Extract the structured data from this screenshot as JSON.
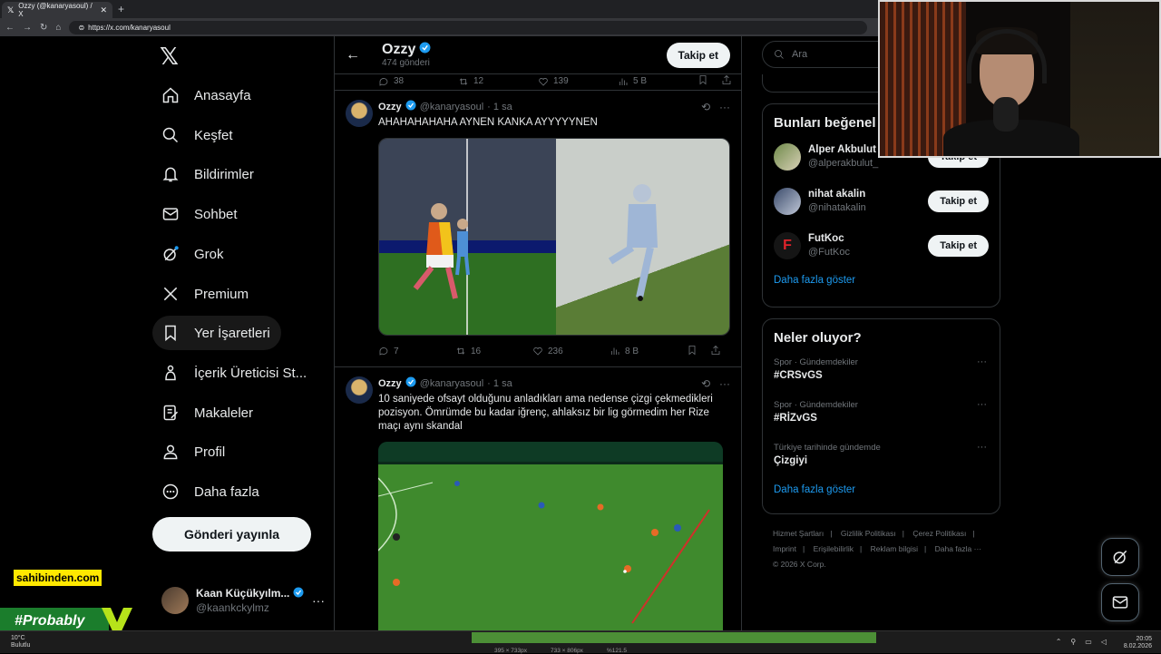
{
  "browser": {
    "tab_title": "Ozzy (@kanaryasoul) / X",
    "url": "https://x.com/kanaryasoul"
  },
  "nav": {
    "items": [
      {
        "label": "Anasayfa",
        "icon": "home-icon"
      },
      {
        "label": "Keşfet",
        "icon": "search-icon"
      },
      {
        "label": "Bildirimler",
        "icon": "bell-icon"
      },
      {
        "label": "Sohbet",
        "icon": "mail-icon"
      },
      {
        "label": "Grok",
        "icon": "grok-icon"
      },
      {
        "label": "Premium",
        "icon": "x-icon"
      },
      {
        "label": "Yer İşaretleri",
        "icon": "bookmark-icon"
      },
      {
        "label": "İçerik Üreticisi St...",
        "icon": "creator-icon"
      },
      {
        "label": "Makaleler",
        "icon": "article-icon"
      },
      {
        "label": "Profil",
        "icon": "person-icon"
      },
      {
        "label": "Daha fazla",
        "icon": "more-circle-icon"
      }
    ],
    "post_button": "Gönderi yayınla",
    "account": {
      "name": "Kaan Küçükyılm...",
      "handle": "@kaankckylmz"
    }
  },
  "profile_header": {
    "name": "Ozzy",
    "posts": "474 gönderi",
    "follow": "Takip et"
  },
  "top_actions": {
    "replies": "38",
    "reposts": "12",
    "likes": "139",
    "views": "5 B"
  },
  "tweets": [
    {
      "name": "Ozzy",
      "handle": "@kanaryasoul",
      "time": "· 1 sa",
      "text": "AHAHAHAHAHA AYNEN KANKA AYYYYYNEN",
      "replies": "7",
      "reposts": "16",
      "likes": "236",
      "views": "8 B"
    },
    {
      "name": "Ozzy",
      "handle": "@kanaryasoul",
      "time": "· 1 sa",
      "text": "10 saniyede ofsayt olduğunu anladıkları ama nedense çizgi çekmedikleri pozisyon. Ömrümde bu kadar iğrenç, ahlaksız bir lig görmedim her Rize maçı aynı skandal"
    }
  ],
  "search": {
    "placeholder": "Ara"
  },
  "who_to_follow": {
    "title": "Bunları beğenel",
    "people": [
      {
        "name": "Alper Akbulut",
        "handle": "@alperakbulut_",
        "button": "Takip et"
      },
      {
        "name": "nihat akalin",
        "handle": "@nihatakalin",
        "button": "Takip et"
      },
      {
        "name": "FutKoc",
        "handle": "@FutKoc",
        "button": "Takip et"
      }
    ],
    "show_more": "Daha fazla göster"
  },
  "trends": {
    "title": "Neler oluyor?",
    "items": [
      {
        "context": "Spor · Gündemdekiler",
        "tag": "#CRSvGS"
      },
      {
        "context": "Spor · Gündemdekiler",
        "tag": "#RİZvGS"
      },
      {
        "context": "Türkiye tarihinde gündemde",
        "tag": "Çizgiyi"
      }
    ],
    "show_more": "Daha fazla göster"
  },
  "footer": {
    "row1": [
      "Hizmet Şartları",
      "|",
      "Gizlilik Politikası",
      "|",
      "Çerez Politikası",
      "|"
    ],
    "row2": [
      "Imprint",
      "|",
      "Erişilebilirlik",
      "|",
      "Reklam bilgisi",
      "|",
      "Daha fazla ···"
    ],
    "copyright": "© 2026 X Corp."
  },
  "overlays": {
    "sahibinden": "sahibinden.com",
    "probably": "#Probably"
  },
  "taskbar": {
    "temp": "10°C",
    "weather": "Bulutlu",
    "info1": "395 × 733px",
    "info2": "733 × 806px",
    "zoom": "%121.5",
    "time": "20:05",
    "date": "8.02.2026"
  },
  "colors": {
    "accent": "#1d9bf0",
    "background": "#000000",
    "border": "#2f3336",
    "muted": "#71767b"
  }
}
